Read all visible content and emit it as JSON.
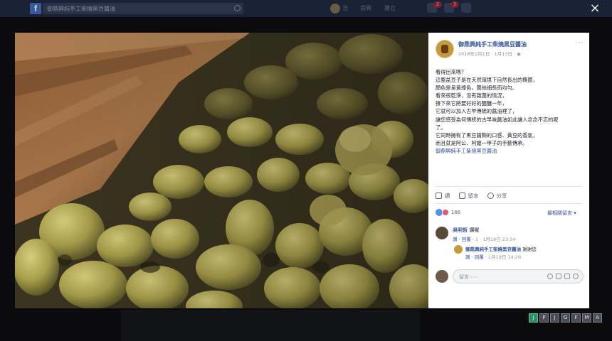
{
  "topbar": {
    "search_text": "御鼎興純手工柴燒黑豆醬油",
    "user_name": "浩",
    "nav_home": "首頁",
    "nav_create": "建立",
    "friends_badge": "2",
    "messages_badge": "3"
  },
  "lightbox": {
    "close_symbol": "×"
  },
  "post": {
    "page_name": "御鼎興純手工柴燒黑豆醬油",
    "meta_text": "2018年2月1日 · 1月13日 · ",
    "more_symbol": "···",
    "lines": [
      "看得出來嗎？",
      "這整盆豆子是在天然環境下自然長出的麴菌，",
      "顏色是呈黃綠色，菌絲細長而均勻。",
      "看來很乾淨，沒有雜菌的情況，",
      "接下來它將要好好的醞釀一年，",
      "它就可以加入古早傳統的醬油裡了，",
      "讓您感受為何傳統的古早味醬油如此讓人念念不忘的呢",
      "了。",
      "它同時擁有了黑豆醬麴的口感、黃豆的香氣，",
      "而且就是阿公、阿嬤一甲子的手藝傳承。"
    ],
    "see_more": "御鼎興純手工柴燒黑豆醬油"
  },
  "actions": {
    "like": "讚",
    "comment": "留言",
    "share": "分享"
  },
  "reactions": {
    "count": "186",
    "sort_label": "最相關留言 ▾"
  },
  "comments": [
    {
      "name": "吳明哲",
      "text": "讚喔",
      "meta_reply": "讚",
      "meta_sep": "· 回覆 ·",
      "meta_time": "1 · 1月18日 23:54"
    },
    {
      "name": "御鼎興純手工柴燒黑豆醬油",
      "text": "謝謝您",
      "meta_reply": "讚",
      "meta_sep": "· 回覆 ·",
      "meta_time": "1月19日 14:26"
    }
  ],
  "comment_input": {
    "placeholder": "留言⋯⋯"
  },
  "toolbar_buttons": [
    "J",
    "P",
    "J",
    "G",
    "F",
    "M",
    "A"
  ]
}
